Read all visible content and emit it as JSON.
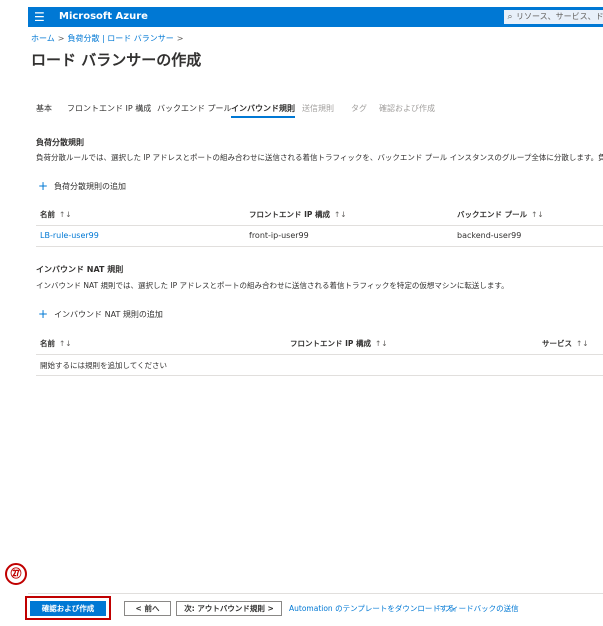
{
  "topbar": {
    "menu_icon": "hamburger-icon",
    "brand": "Microsoft Azure",
    "search_placeholder": "リソース、サービス、ドキュメ"
  },
  "breadcrumb": {
    "items": [
      "ホーム",
      "負荷分散 | ロード バランサー"
    ]
  },
  "page": {
    "title": "ロード バランサーの作成",
    "more": "···"
  },
  "tabs": [
    {
      "label": "基本",
      "state": "normal"
    },
    {
      "label": "フロントエンド IP 構成",
      "state": "normal"
    },
    {
      "label": "バックエンド プール",
      "state": "normal"
    },
    {
      "label": "インバウンド規則",
      "state": "active"
    },
    {
      "label": "送信規則",
      "state": "disabled"
    },
    {
      "label": "タグ",
      "state": "disabled"
    },
    {
      "label": "確認および作成",
      "state": "disabled"
    }
  ],
  "lb_rules": {
    "heading": "負荷分散規則",
    "description": "負荷分散ルールでは、選択した IP アドレスとポートの組み合わせに送信される着信トラフィックを、バックエンド プール インスタンスのグループ全体に分散します。負荷分散ルールでは、正常",
    "add_label": "負荷分散規則の追加",
    "columns": [
      "名前",
      "フロントエンド IP 構成",
      "バックエンド プール"
    ],
    "rows": [
      {
        "name": "LB-rule-user99",
        "frontend": "front-ip-user99",
        "backend": "backend-user99"
      }
    ]
  },
  "nat_rules": {
    "heading": "インバウンド NAT 規則",
    "description": "インバウンド NAT 規則では、選択した IP アドレスとポートの組み合わせに送信される着信トラフィックを特定の仮想マシンに転送します。",
    "add_label": "インバウンド NAT 規則の追加",
    "columns": [
      "名前",
      "フロントエンド IP 構成",
      "サービス"
    ],
    "empty_text": "開始するには規則を追加してください"
  },
  "sort_glyph": "↑↓",
  "footer": {
    "callout": "㉗",
    "review_create": "確認および作成",
    "previous": "< 前へ",
    "next": "次: アウトバウンド規則 >",
    "download_template": "Automation のテンプレートをダウンロードする",
    "feedback": "フィードバックの送信"
  },
  "colors": {
    "accent": "#0078d4",
    "callout": "#c00000"
  }
}
